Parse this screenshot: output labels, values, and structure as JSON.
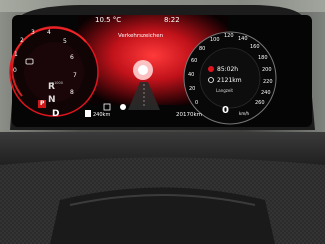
{
  "topbar": {
    "outside_temperature": "10.5 °C",
    "clock": "8:22"
  },
  "center_display": {
    "title": "Verkehrszeichen"
  },
  "tachometer": {
    "scale_labels": [
      "0",
      "1",
      "2",
      "3",
      "4",
      "5",
      "6",
      "7",
      "8"
    ],
    "multiplier_label": "x1000"
  },
  "gear_selector": {
    "park": "P",
    "reverse": "R",
    "neutral": "N",
    "drive": "D"
  },
  "speedometer": {
    "scale_labels": [
      "0",
      "20",
      "40",
      "60",
      "80",
      "100",
      "120",
      "140",
      "160",
      "180",
      "200",
      "220",
      "240",
      "260"
    ],
    "current_speed": "0",
    "speed_unit": "km/h"
  },
  "trip_info": {
    "drive_time": "85:02h",
    "distance": "2121km",
    "label": "Langzeit"
  },
  "bottom_bar": {
    "range": "240km",
    "odometer": "20170km"
  },
  "colors": {
    "accent_red": "#e0141e",
    "screen_black": "#050505",
    "dashboard_dark": "#1e1e1e"
  },
  "icons": [
    "engine-warning-icon",
    "pedestrian-assist-icon",
    "lane-assist-icon",
    "fuel-pump-icon",
    "trip-clock-icon"
  ]
}
